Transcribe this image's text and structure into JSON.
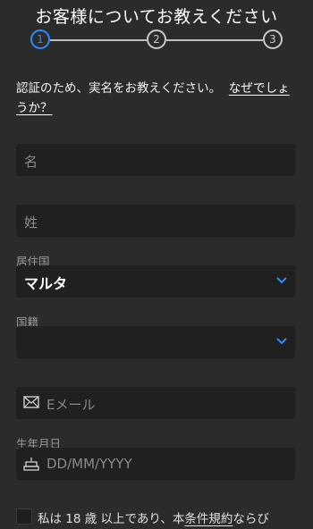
{
  "header": {
    "title": "お客様についてお教えください"
  },
  "stepper": {
    "steps": [
      "1",
      "2",
      "3"
    ],
    "active_step": 1
  },
  "intro": {
    "text": "認証のため、実名をお教えください。",
    "link": "なぜでしょうか？"
  },
  "form": {
    "first_name": {
      "placeholder": "名"
    },
    "last_name": {
      "placeholder": "姓"
    },
    "country": {
      "label": "居住国",
      "value": "マルタ"
    },
    "nationality": {
      "label": "国籍",
      "value": ""
    },
    "email": {
      "placeholder": "Eメール"
    },
    "birthdate": {
      "label": "生年月日",
      "placeholder": "DD/MM/YYYY"
    }
  },
  "terms": {
    "prefix": "私は 18 歳 以上であり、本",
    "link": "条件規約",
    "suffix": "ならび"
  },
  "colors": {
    "accent": "#2d8cff",
    "background": "#2b2b2b",
    "field": "#202020"
  },
  "icons": [
    "envelope-icon",
    "cake-icon",
    "chevron-down-icon"
  ]
}
